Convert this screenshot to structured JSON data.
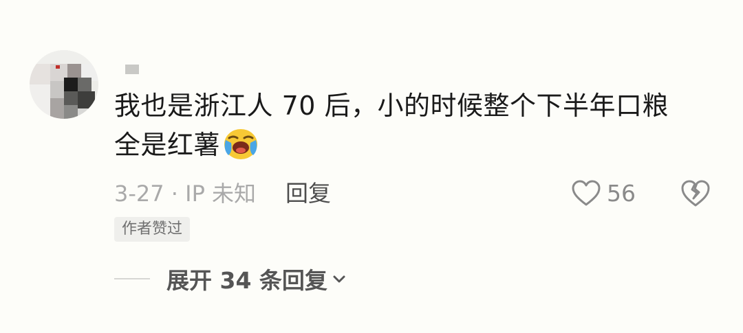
{
  "comment": {
    "text_line1": "我也是浙江人 70 后，小的时候整个下半年口粮",
    "text_line2": "全是红薯",
    "emoji": "crying-laughing-emoji",
    "meta": "3-27 · IP 未知",
    "reply_label": "回复",
    "like_count": "56",
    "badge": "作者赞过",
    "expand_label": "展开 34 条回复"
  },
  "colors": {
    "background": "#fdfdf9",
    "text": "#1a1a1a",
    "meta": "#a9a9a9",
    "badge_bg": "#efefec",
    "emoji_yellow": "#f7c935",
    "emoji_blue": "#4aa6e6"
  }
}
